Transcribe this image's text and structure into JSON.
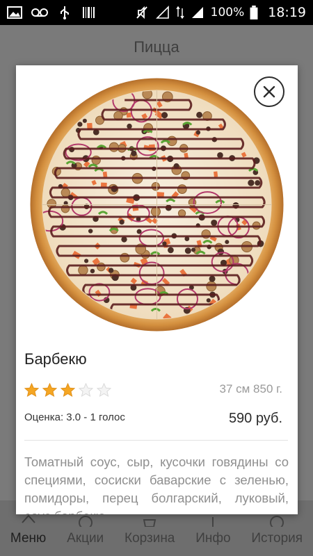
{
  "status_bar": {
    "battery": "100%",
    "time": "18:19",
    "icons": [
      "gallery-icon",
      "voicemail-icon",
      "usb-icon",
      "barcode-icon",
      "mute-icon",
      "signal-empty-icon",
      "data-arrows-icon",
      "signal-full-icon",
      "battery-icon"
    ]
  },
  "appbar": {
    "title": "Пицца"
  },
  "dialog": {
    "title": "Барбекю",
    "rating_value": 3,
    "rating_max": 5,
    "size_weight": "37 см 850 г.",
    "rating_text": "Оценка: 3.0 - 1 голос",
    "price": "590 руб.",
    "description": "Томатный соус, сыр, кусочки говядины со специями, сосиски баварские с зеленью, помидоры, перец болгарский, луковый, соус барбекю"
  },
  "bottom_nav": [
    {
      "label": "Меню",
      "icon": "menu-icon",
      "active": true
    },
    {
      "label": "Акции",
      "icon": "promo-icon",
      "active": false
    },
    {
      "label": "Корзина",
      "icon": "cart-icon",
      "active": false
    },
    {
      "label": "Инфо",
      "icon": "info-icon",
      "active": false
    },
    {
      "label": "История",
      "icon": "history-icon",
      "active": false
    }
  ],
  "colors": {
    "star_filled": "#f5a623",
    "star_empty": "#d9d9d9",
    "overlay": "#7a7a7a"
  }
}
